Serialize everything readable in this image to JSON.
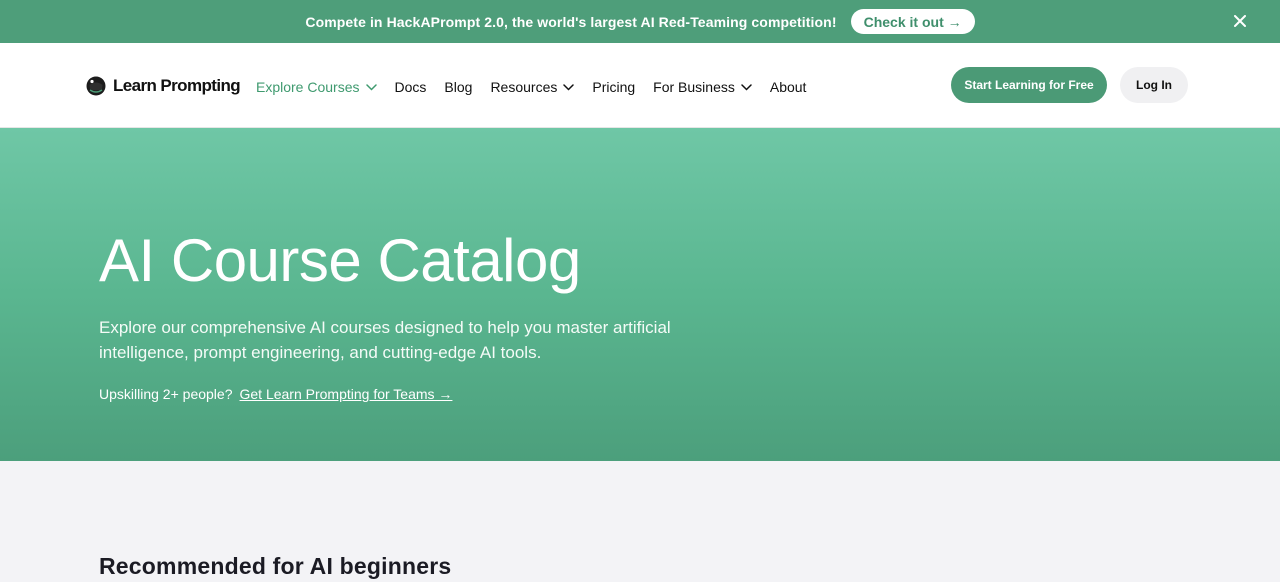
{
  "banner": {
    "text": "Compete in HackAPrompt 2.0, the world's largest AI Red-Teaming competition!",
    "cta": "Check it out →",
    "close_icon": "close-icon"
  },
  "header": {
    "logo_text": "Learn Prompting",
    "logo_icon": "astronaut-helmet-icon",
    "nav": [
      {
        "label": "Explore Courses",
        "dropdown": true,
        "active": true
      },
      {
        "label": "Docs",
        "dropdown": false,
        "active": false
      },
      {
        "label": "Blog",
        "dropdown": false,
        "active": false
      },
      {
        "label": "Resources",
        "dropdown": true,
        "active": false
      },
      {
        "label": "Pricing",
        "dropdown": false,
        "active": false
      },
      {
        "label": "For Business",
        "dropdown": true,
        "active": false
      },
      {
        "label": "About",
        "dropdown": false,
        "active": false
      }
    ],
    "start_button": "Start Learning for Free",
    "login_button": "Log In"
  },
  "hero": {
    "title": "AI Course Catalog",
    "subtitle": "Explore our comprehensive AI courses designed to help you master artificial intelligence, prompt engineering, and cutting-edge AI tools.",
    "teams_prefix": "Upskilling 2+ people?",
    "teams_link": "Get Learn Prompting for Teams →"
  },
  "section": {
    "title": "Recommended for AI beginners"
  },
  "colors": {
    "brand_green": "#4b9a76",
    "active_nav": "#3f9a6f",
    "hero_top": "#6fc7a6",
    "hero_bottom": "#4c9f7c"
  }
}
